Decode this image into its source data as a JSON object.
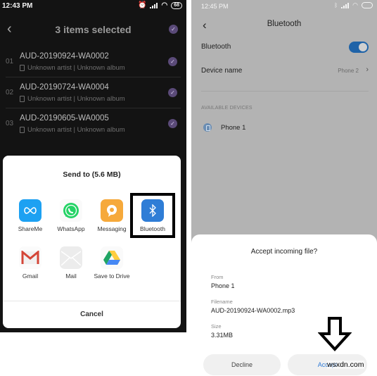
{
  "left_screen": {
    "status_bar": {
      "time": "12:43 PM",
      "battery": "68",
      "icons": [
        "alarm-icon",
        "signal-icon",
        "wifi-icon",
        "battery-icon"
      ]
    },
    "header": {
      "back_icon": "‹",
      "title": "3 items selected",
      "select_all_checked": true
    },
    "files": [
      {
        "index": "01",
        "name": "AUD-20190924-WA0002",
        "meta": "Unknown artist | Unknown album",
        "checked": true
      },
      {
        "index": "02",
        "name": "AUD-20190724-WA0004",
        "meta": "Unknown artist | Unknown album",
        "checked": true
      },
      {
        "index": "03",
        "name": "AUD-20190605-WA0005",
        "meta": "Unknown artist | Unknown album",
        "checked": true
      }
    ],
    "share_sheet": {
      "title": "Send to (5.6 MB)",
      "apps": [
        {
          "label": "ShareMe",
          "icon": "shareme-icon",
          "color": "#1da1f2"
        },
        {
          "label": "WhatsApp",
          "icon": "whatsapp-icon",
          "color": "#25d366"
        },
        {
          "label": "Messaging",
          "icon": "messaging-icon",
          "color": "#f6a93b"
        },
        {
          "label": "Bluetooth",
          "icon": "bluetooth-icon",
          "color": "#2f7dd6",
          "highlighted": true
        },
        {
          "label": "Gmail",
          "icon": "gmail-icon",
          "color": "#d44638"
        },
        {
          "label": "Mail",
          "icon": "mail-icon",
          "color": "#e0e0e0"
        },
        {
          "label": "Save to Drive",
          "icon": "drive-icon",
          "color": "#1fa463"
        }
      ],
      "cancel_label": "Cancel"
    }
  },
  "right_screen": {
    "status_bar": {
      "time": "12:45 PM",
      "icons": [
        "bluetooth-icon",
        "signal-icon",
        "wifi-icon",
        "battery-icon"
      ]
    },
    "header": {
      "back_icon": "‹",
      "title": "Bluetooth"
    },
    "bluetooth_toggle": {
      "label": "Bluetooth",
      "on": true
    },
    "device_name": {
      "label": "Device name",
      "value": "Phone 2",
      "chevron": "›"
    },
    "available_devices_label": "AVAILABLE DEVICES",
    "available_devices": [
      {
        "name": "Phone 1"
      }
    ],
    "dialog": {
      "title": "Accept incoming file?",
      "fields": [
        {
          "label": "From",
          "value": "Phone 1"
        },
        {
          "label": "Filename",
          "value": "AUD-20190924-WA0002.mp3"
        },
        {
          "label": "Size",
          "value": "3.31MB"
        }
      ],
      "decline_label": "Decline",
      "accept_label": "Accept"
    }
  },
  "watermark": "wsxdn.com",
  "colors": {
    "accent_purple": "#5a4a78",
    "toggle_blue": "#1f63a8",
    "accept_blue": "#2f7bd6"
  }
}
